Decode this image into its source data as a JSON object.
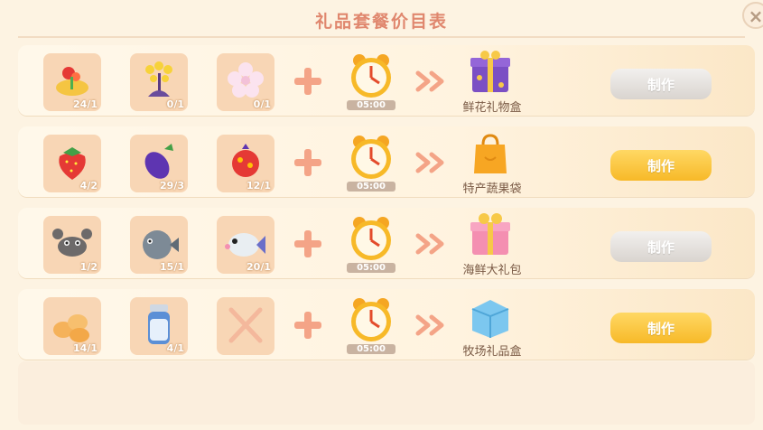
{
  "title": "礼品套餐价目表",
  "close_icon": "close-icon",
  "recipes": [
    {
      "ingredients": [
        {
          "icon": "red-flower-icon",
          "count": "24/1"
        },
        {
          "icon": "yellow-flower-icon",
          "count": "0/1"
        },
        {
          "icon": "white-flower-icon",
          "count": "0/1"
        }
      ],
      "time": "05:00",
      "result": {
        "icon": "purple-gift-box-icon",
        "name": "鲜花礼物盒"
      },
      "button": {
        "label": "制作",
        "state": "disabled"
      }
    },
    {
      "ingredients": [
        {
          "icon": "strawberry-icon",
          "count": "4/2"
        },
        {
          "icon": "eggplant-icon",
          "count": "29/3"
        },
        {
          "icon": "red-fruit-icon",
          "count": "12/1"
        }
      ],
      "time": "05:00",
      "result": {
        "icon": "orange-bag-icon",
        "name": "特产蔬果袋"
      },
      "button": {
        "label": "制作",
        "state": "enabled"
      }
    },
    {
      "ingredients": [
        {
          "icon": "crab-icon",
          "count": "1/2"
        },
        {
          "icon": "pufferfish-icon",
          "count": "15/1"
        },
        {
          "icon": "white-fish-icon",
          "count": "20/1"
        }
      ],
      "time": "05:00",
      "result": {
        "icon": "pink-gift-box-icon",
        "name": "海鲜大礼包"
      },
      "button": {
        "label": "制作",
        "state": "disabled"
      }
    },
    {
      "ingredients": [
        {
          "icon": "eggs-icon",
          "count": "14/1"
        },
        {
          "icon": "milk-jar-icon",
          "count": "4/1"
        },
        {
          "icon": "empty-slot-x-icon",
          "count": ""
        }
      ],
      "time": "05:00",
      "result": {
        "icon": "blue-gift-box-icon",
        "name": "牧场礼品盒"
      },
      "button": {
        "label": "制作",
        "state": "enabled"
      }
    }
  ],
  "colors": {
    "title": "#e0876e",
    "button_enabled": "#f7b928",
    "button_disabled": "#d9d4cf",
    "slot_bg": "#f8d6b5",
    "plus": "#f4a487"
  }
}
